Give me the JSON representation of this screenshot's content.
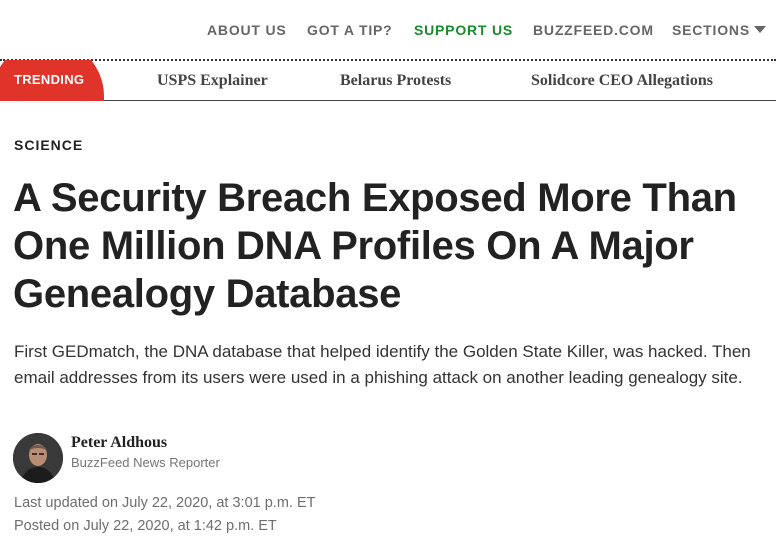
{
  "topnav": {
    "about": "ABOUT US",
    "tip": "GOT A TIP?",
    "support": "SUPPORT US",
    "buzzfeed": "BUZZFEED.COM",
    "sections": "SECTIONS",
    "support_color": "#1a8a2f"
  },
  "trending": {
    "label": "TRENDING",
    "badge_color": "#e0342a",
    "items": [
      {
        "label": "USPS Explainer"
      },
      {
        "label": "Belarus Protests"
      },
      {
        "label": "Solidcore CEO Allegations"
      }
    ]
  },
  "article": {
    "category": "SCIENCE",
    "headline": "A Security Breach Exposed More Than One Million DNA Profiles On A Major Genealogy Database",
    "dek": "First GEDmatch, the DNA database that helped identify the Golden State Killer, was hacked. Then email addresses from its users were used in a phishing attack on another leading genealogy site.",
    "author": {
      "name": "Peter Aldhous",
      "title": "BuzzFeed News Reporter",
      "avatar_icon": "author-photo"
    },
    "updated": "Last updated on July 22, 2020, at 3:01 p.m. ET",
    "posted": "Posted on July 22, 2020, at 1:42 p.m. ET"
  }
}
